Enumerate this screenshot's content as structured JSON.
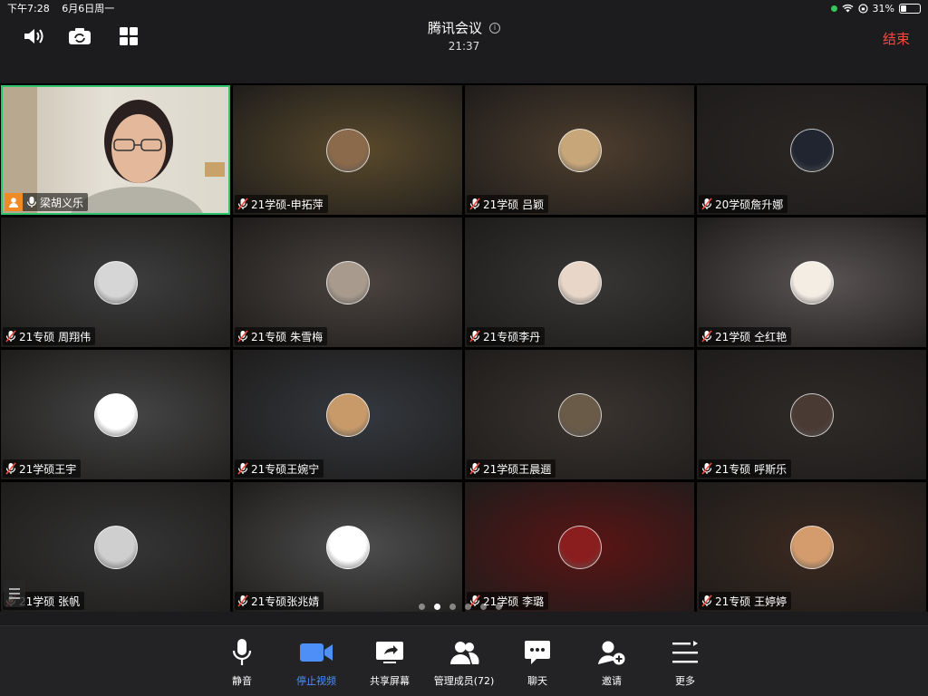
{
  "status_bar": {
    "time": "下午7:28",
    "date": "6月6日周一",
    "battery": "31%",
    "battery_level": 0.31
  },
  "header": {
    "title": "腾讯会议",
    "timer": "21:37",
    "end_label": "结束"
  },
  "participants": [
    {
      "name": "梁胡义乐",
      "self": true,
      "muted": false,
      "tile_bg": "#d8d2c4",
      "avatar_color": ""
    },
    {
      "name": "21学硕-申拓萍",
      "muted": true,
      "tile_bg": "#5a4a2c",
      "avatar_color": "#8a6a4a"
    },
    {
      "name": "21学硕 吕颖",
      "muted": true,
      "tile_bg": "#4e3e2e",
      "avatar_color": "#c7a77a"
    },
    {
      "name": "20学硕詹升娜",
      "muted": true,
      "tile_bg": "#2a2624",
      "avatar_color": "#202530"
    },
    {
      "name": "21专硕 周翔伟",
      "muted": true,
      "tile_bg": "#3e3e3e",
      "avatar_color": "#d6d6d6"
    },
    {
      "name": "21专硕 朱雪梅",
      "muted": true,
      "tile_bg": "#4b4440",
      "avatar_color": "#a89a8c"
    },
    {
      "name": "21专硕李丹",
      "muted": true,
      "tile_bg": "#383634",
      "avatar_color": "#e8d6c8"
    },
    {
      "name": "21学硕 仝红艳",
      "muted": true,
      "tile_bg": "#5a5454",
      "avatar_color": "#f4ede4"
    },
    {
      "name": "21学硕王宇",
      "muted": true,
      "tile_bg": "#464646",
      "avatar_color": "#ffffff"
    },
    {
      "name": "21专硕王婉宁",
      "muted": true,
      "tile_bg": "#34383e",
      "avatar_color": "#c89a6a"
    },
    {
      "name": "21学硕王晨逦",
      "muted": true,
      "tile_bg": "#3a3430",
      "avatar_color": "#6a5a48"
    },
    {
      "name": "21专硕 呼斯乐",
      "muted": true,
      "tile_bg": "#2e2a28",
      "avatar_color": "#4a3a34"
    },
    {
      "name": "21学硕 张帆",
      "muted": true,
      "tile_bg": "#353535",
      "avatar_color": "#cfcfcf"
    },
    {
      "name": "21专硕张兆婧",
      "muted": true,
      "tile_bg": "#4e4e4e",
      "avatar_color": "#ffffff"
    },
    {
      "name": "21学硕 李璐",
      "muted": true,
      "tile_bg": "#5a1414",
      "avatar_color": "#8a1e1e"
    },
    {
      "name": "21专硕 王婷婷",
      "muted": true,
      "tile_bg": "#3c2a20",
      "avatar_color": "#d49c6c"
    }
  ],
  "pagination": {
    "pages": 6,
    "current": 2
  },
  "toolbar": {
    "items": [
      {
        "label": "静音",
        "icon": "microphone-icon",
        "active": false
      },
      {
        "label": "停止视频",
        "icon": "video-camera-icon",
        "active": true
      },
      {
        "label": "共享屏幕",
        "icon": "share-screen-icon",
        "active": false
      },
      {
        "label": "管理成员(72)",
        "icon": "members-icon",
        "active": false
      },
      {
        "label": "聊天",
        "icon": "chat-icon",
        "active": false
      },
      {
        "label": "邀请",
        "icon": "invite-icon",
        "active": false
      },
      {
        "label": "更多",
        "icon": "more-icon",
        "active": false
      }
    ]
  },
  "colors": {
    "accent": "#4d8ef7",
    "end": "#f24b3f",
    "speaking_border": "#2fc36b",
    "host_badge": "#f08a24"
  }
}
